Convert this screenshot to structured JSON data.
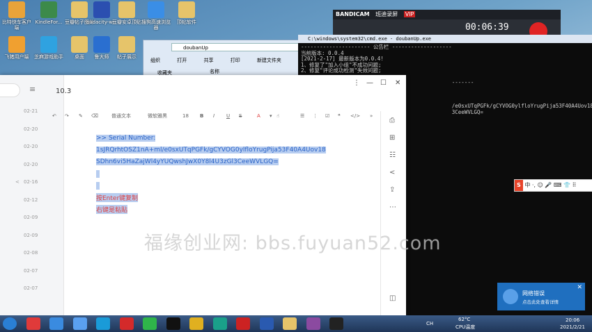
{
  "desktop": {
    "icons": [
      {
        "label": "比特快车客户端",
        "color": "#e8a33a"
      },
      {
        "label": "KindleFor...",
        "color": "#3c8a4a"
      },
      {
        "label": "豆瓣帖子图片",
        "color": "#e6c46a"
      },
      {
        "label": "audacity-w...",
        "color": "#2b4fb0"
      },
      {
        "label": "豆瓣安卓顶贴",
        "color": "#e6c46a"
      },
      {
        "label": "搜狗高速浏览器",
        "color": "#3a8ee6"
      },
      {
        "label": "顶帖软件",
        "color": "#e6c46a"
      },
      {
        "label": "飞猪用户端",
        "color": "#f0a030"
      },
      {
        "label": "芝麻游戏助手",
        "color": "#2fa2e0"
      },
      {
        "label": "桌面",
        "color": "#e6c46a"
      },
      {
        "label": "鲁大师",
        "color": "#2a6fd0"
      },
      {
        "label": "帖子展示",
        "color": "#e6c46a"
      }
    ]
  },
  "explorer": {
    "address": "doubanUp",
    "toolbar": [
      "组织",
      "打开",
      "共享",
      "打印",
      "新建文件夹"
    ],
    "nav_item": "收藏夹",
    "column": "名称"
  },
  "bandicam": {
    "title": "BANDICAM",
    "subtitle": "班迪录屏",
    "vip": "VIP",
    "timer": "00:06:39"
  },
  "cmd": {
    "title": "C:\\windows\\system32\\cmd.exe - doubanUp.exe",
    "lines": [
      "---------------------- 公告栏 -------------------",
      "当前版本: 0.0.4",
      "[2021-2-17] 最新版本为0.0.4!",
      "1、修复了\"加入小组\"不成功问题;",
      "2、修复\"评论成功检测\"失效问题;",
      "",
      "                                                -------",
      "",
      "",
      "",
      "                                                /e0sxUTqPGFk/gCYVOG0ylfloYrugPija53F40A4Uov18",
      "                                                3CeeWVLGQ="
    ]
  },
  "sogou": {
    "text": "中 ·, ☺ 🎤 ⌨ 👕 ⠿"
  },
  "notification": {
    "title": "网络错误",
    "subtitle": "点击此处查看详情"
  },
  "notes_app": {
    "note_title": "10.3",
    "dates": [
      "02-21",
      "02-20",
      "02-20",
      "02-20",
      "02-16",
      "02-12",
      "02-09",
      "02-09",
      "02-08",
      "02-07",
      "02-07"
    ],
    "toolbar": {
      "style": "普通文本",
      "font": "微软雅黑",
      "size": "18",
      "bold": "B",
      "italic": "I",
      "underline": "U",
      "strike": "S"
    },
    "content": [
      ">> Serial Number:",
      "1sJRQrhtOSZ1nA+ml/e0sxUTqPGFk/gCYVOG0ylfloYrugPija53F40A4Uov18",
      "SDhn6vi5HaZajWl4yYUQwshJwX0Y8l4U3zGl3CeeWVLGQ=",
      "",
      "",
      "按Enter键复制",
      "右键是粘贴"
    ]
  },
  "watermark": "福缘创业网: bbs.fuyuan52.com",
  "taskbar": {
    "ime": "CH",
    "temp": "62°C",
    "cpu": "CPU温度",
    "time": "20:06",
    "date": "2021/2/21",
    "icons": [
      "start",
      "browser-360",
      "notes",
      "baidu-netdisk",
      "ie-alt",
      "netease-music",
      "wechat",
      "qq",
      "chrome",
      "visual-studio",
      "record",
      "word",
      "file-explorer",
      "winrar",
      "cmd"
    ]
  }
}
